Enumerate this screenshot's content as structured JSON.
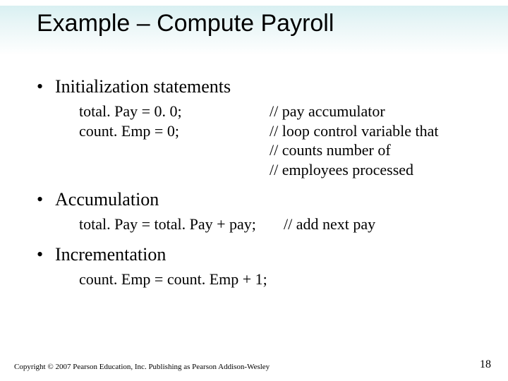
{
  "title": "Example – Compute Payroll",
  "bullets": {
    "b1": {
      "label": "Initialization statements"
    },
    "b2": {
      "label": "Accumulation"
    },
    "b3": {
      "label": "Incrementation"
    }
  },
  "init": {
    "line1_code": "total. Pay = 0. 0;",
    "line1_comment": "// pay accumulator",
    "line2_code": "count. Emp = 0;",
    "line2_comment1": "// loop control variable that",
    "line2_comment2": "// counts number of",
    "line2_comment3": "// employees processed"
  },
  "accum": {
    "code": "total. Pay = total. Pay + pay;",
    "comment": "// add next pay"
  },
  "incr": {
    "code": "count. Emp = count. Emp + 1;"
  },
  "footer": "Copyright © 2007 Pearson Education, Inc. Publishing as Pearson Addison-Wesley",
  "page_number": "18"
}
